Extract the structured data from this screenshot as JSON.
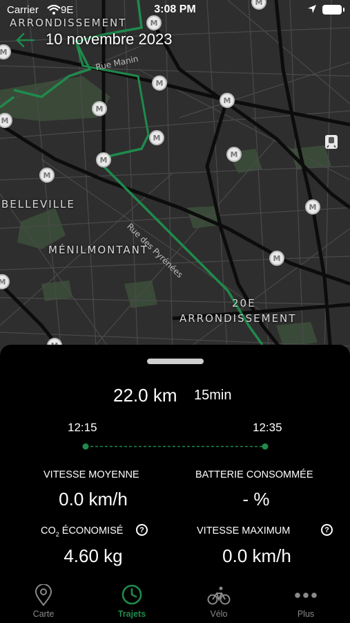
{
  "status_bar": {
    "carrier": "Carrier",
    "time": "3:08 PM",
    "network": "9E"
  },
  "header": {
    "date": "10 novembre 2023"
  },
  "map": {
    "labels": {
      "arrondissement_top": "ARRONDISSEMENT",
      "belleville": "BELLEVILLE",
      "menilmontant": "MÉNILMONTANT",
      "arr_20_num": "20E",
      "arr_20": "ARRONDISSEMENT"
    },
    "streets": {
      "rue_manin": "Rue Manin",
      "rue_pyrenees": "Rue des Pyrénées"
    },
    "metro_symbol": "M",
    "route_color": "#1f8a4c"
  },
  "trip": {
    "distance": "22.0 km",
    "duration": "15min",
    "start_time": "12:15",
    "end_time": "12:35"
  },
  "stats": {
    "avg_speed_label": "VITESSE MOYENNE",
    "avg_speed_value": "0.0 km/h",
    "battery_label": "BATTERIE CONSOMMÉE",
    "battery_value": "- %",
    "co2_label_prefix": "CO",
    "co2_label_sub": "2",
    "co2_label_suffix": " ÉCONOMISÉ",
    "co2_value": "4.60 kg",
    "max_speed_label": "VITESSE MAXIMUM",
    "max_speed_value": "0.0 km/h",
    "help_symbol": "?"
  },
  "tabs": [
    {
      "label": "Carte",
      "icon": "map-pin-icon"
    },
    {
      "label": "Trajets",
      "icon": "clock-icon"
    },
    {
      "label": "Vélo",
      "icon": "bike-icon"
    },
    {
      "label": "Plus",
      "icon": "more-dots-icon"
    }
  ],
  "colors": {
    "accent": "#1f8a4c",
    "map_bg": "#2e2e2e",
    "sheet_bg": "#000000"
  }
}
